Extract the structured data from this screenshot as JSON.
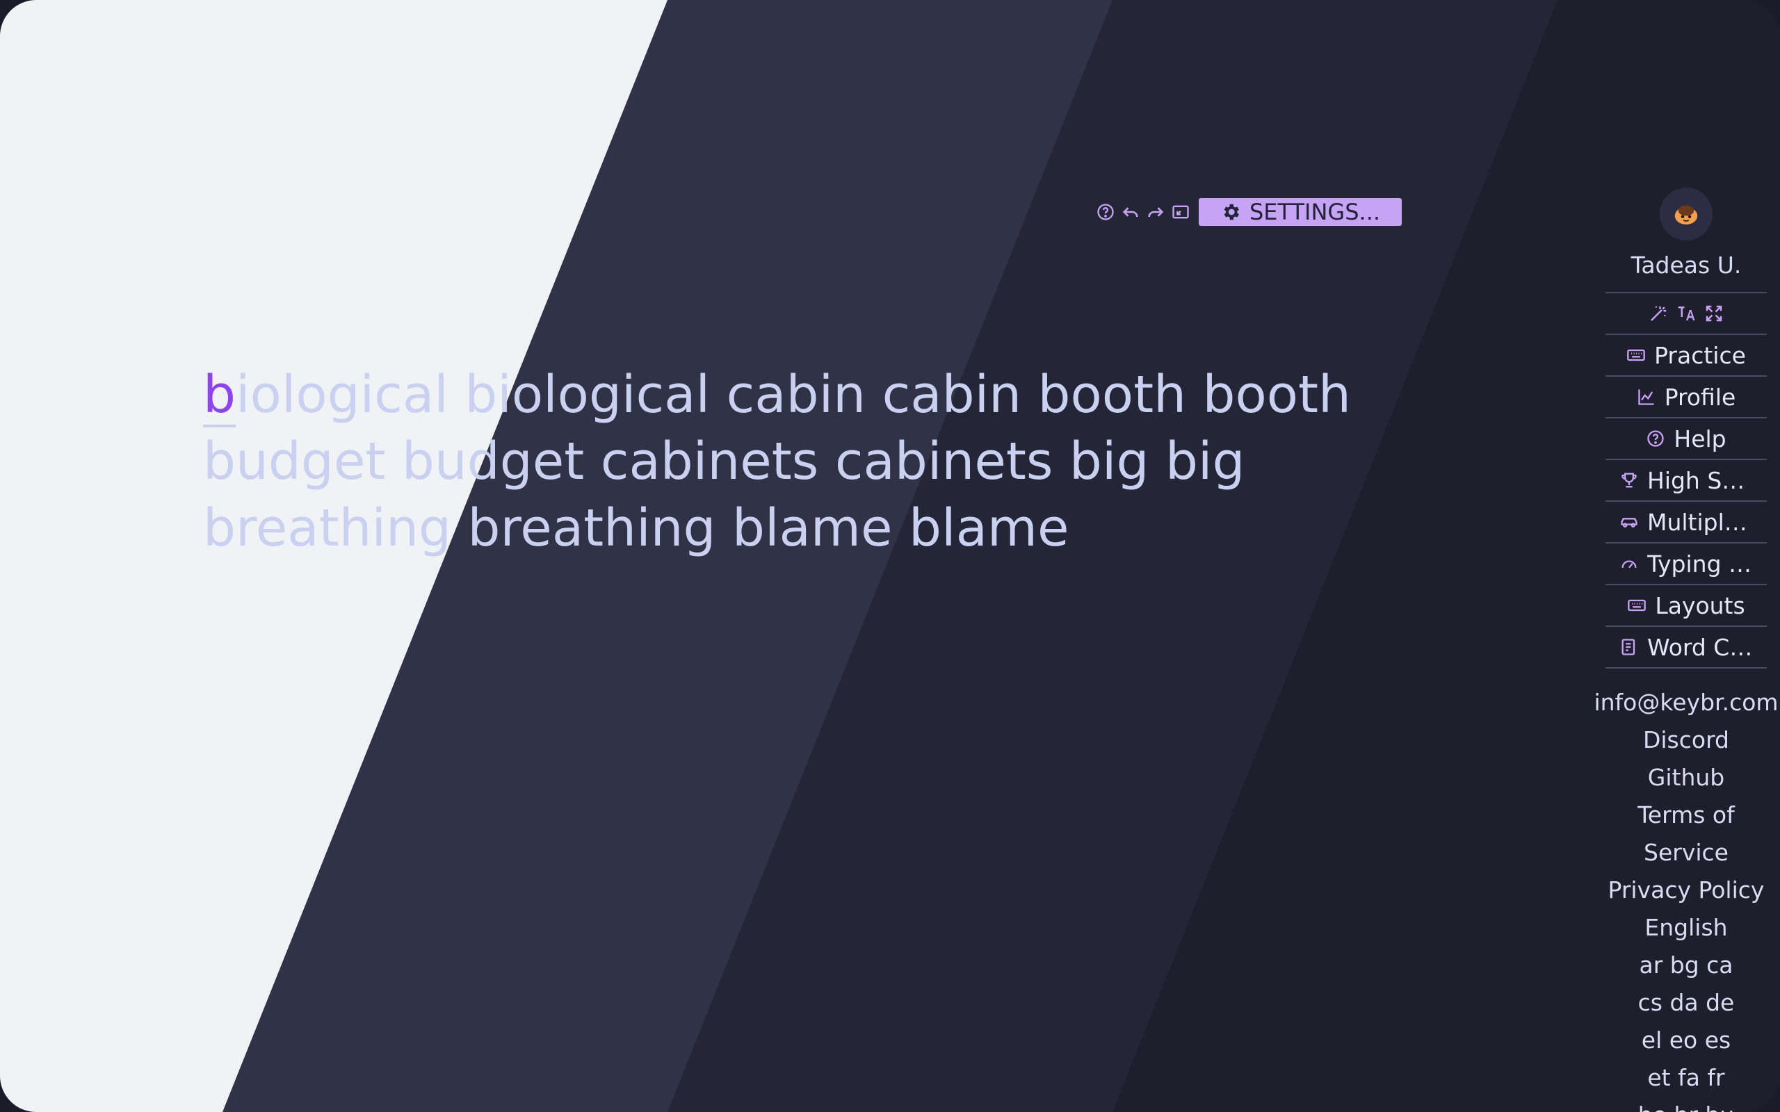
{
  "toolbar": {
    "icons": [
      "help-icon",
      "undo-icon",
      "redo-icon",
      "fullscreen-icon"
    ],
    "settings_label": "SETTINGS..."
  },
  "typing": {
    "cursor_char": "b",
    "line1_rest": "iological biological cabin cabin booth booth",
    "line2": "budget budget cabinets cabinets big big",
    "line3": "breathing breathing blame blame"
  },
  "sidebar": {
    "user_name": "Tadeas U.",
    "nav": [
      {
        "label": "Practice",
        "icon": "keyboard-icon"
      },
      {
        "label": "Profile",
        "icon": "chart-icon"
      },
      {
        "label": "Help",
        "icon": "help-icon"
      },
      {
        "label": "High Scores",
        "icon": "trophy-icon"
      },
      {
        "label": "Multiplayer",
        "icon": "car-icon"
      },
      {
        "label": "Typing Test",
        "icon": "speedometer-icon"
      },
      {
        "label": "Layouts",
        "icon": "keyboard-icon"
      },
      {
        "label": "Word Count",
        "icon": "document-icon"
      }
    ],
    "footer": {
      "email": "info@keybr.com",
      "discord": "Discord",
      "github": "Github",
      "terms_1": "Terms of",
      "terms_2": "Service",
      "privacy": "Privacy Policy",
      "language": "English",
      "langs_1": "ar bg ca",
      "langs_2": "cs da de",
      "langs_3": "el eo es",
      "langs_4": "et fa fr",
      "langs_5": "he hr hu"
    }
  },
  "colors": {
    "accent": "#c7a3f5",
    "cursor": "#8e44ec",
    "light_band": "#f1f2f6",
    "band_2": "#303246",
    "band_3": "#242638",
    "band_4": "#1e1e2d"
  }
}
